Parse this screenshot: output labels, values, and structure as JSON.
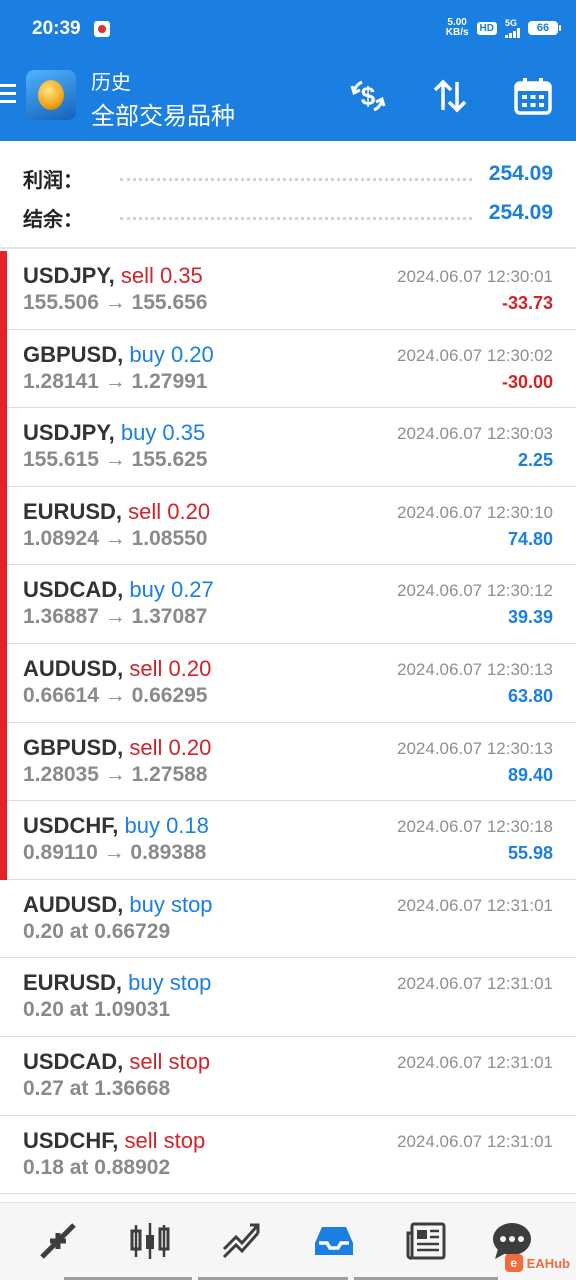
{
  "status_bar": {
    "time": "20:39",
    "net_speed_value": "5.00",
    "net_speed_unit": "KB/s",
    "hd_label": "HD",
    "signal_label": "5G",
    "battery": "66"
  },
  "header": {
    "section": "历史",
    "filter": "全部交易品种",
    "icons": [
      "menu-icon",
      "app-logo",
      "currency-exchange-icon",
      "sort-icon",
      "calendar-icon"
    ]
  },
  "summary": {
    "profit_label": "利润：",
    "profit_value": "254.09",
    "balance_label": "结余：",
    "balance_value": "254.09"
  },
  "trades": [
    {
      "symbol": "USDJPY",
      "sep": ",",
      "type": "sell 0.35",
      "side": "sell",
      "prices": "155.506 → 155.656",
      "time": "2024.06.07 12:30:01",
      "profit": "-33.73",
      "closed": true
    },
    {
      "symbol": "GBPUSD",
      "sep": ",",
      "type": "buy 0.20",
      "side": "buy",
      "prices": "1.28141 → 1.27991",
      "time": "2024.06.07 12:30:02",
      "profit": "-30.00",
      "closed": true
    },
    {
      "symbol": "USDJPY",
      "sep": ",",
      "type": "buy 0.35",
      "side": "buy",
      "prices": "155.615 → 155.625",
      "time": "2024.06.07 12:30:03",
      "profit": "2.25",
      "closed": true
    },
    {
      "symbol": "EURUSD",
      "sep": ",",
      "type": "sell 0.20",
      "side": "sell",
      "prices": "1.08924 → 1.08550",
      "time": "2024.06.07 12:30:10",
      "profit": "74.80",
      "closed": true
    },
    {
      "symbol": "USDCAD",
      "sep": ",",
      "type": "buy 0.27",
      "side": "buy",
      "prices": "1.36887 → 1.37087",
      "time": "2024.06.07 12:30:12",
      "profit": "39.39",
      "closed": true
    },
    {
      "symbol": "AUDUSD",
      "sep": ",",
      "type": "sell 0.20",
      "side": "sell",
      "prices": "0.66614 → 0.66295",
      "time": "2024.06.07 12:30:13",
      "profit": "63.80",
      "closed": true
    },
    {
      "symbol": "GBPUSD",
      "sep": ",",
      "type": "sell 0.20",
      "side": "sell",
      "prices": "1.28035 → 1.27588",
      "time": "2024.06.07 12:30:13",
      "profit": "89.40",
      "closed": true
    },
    {
      "symbol": "USDCHF",
      "sep": ",",
      "type": "buy 0.18",
      "side": "buy",
      "prices": "0.89110 → 0.89388",
      "time": "2024.06.07 12:30:18",
      "profit": "55.98",
      "closed": true
    },
    {
      "symbol": "AUDUSD",
      "sep": ",",
      "type": "buy stop",
      "side": "buy",
      "prices": "0.20 at 0.66729",
      "time": "2024.06.07 12:31:01",
      "profit": "",
      "closed": false
    },
    {
      "symbol": "EURUSD",
      "sep": ",",
      "type": "buy stop",
      "side": "buy",
      "prices": "0.20 at 1.09031",
      "time": "2024.06.07 12:31:01",
      "profit": "",
      "closed": false
    },
    {
      "symbol": "USDCAD",
      "sep": ",",
      "type": "sell stop",
      "side": "sell",
      "prices": "0.27 at 1.36668",
      "time": "2024.06.07 12:31:01",
      "profit": "",
      "closed": false
    },
    {
      "symbol": "USDCHF",
      "sep": ",",
      "type": "sell stop",
      "side": "sell",
      "prices": "0.18 at 0.88902",
      "time": "2024.06.07 12:31:01",
      "profit": "",
      "closed": false
    }
  ],
  "bottom_nav": {
    "items": [
      "quotes-icon",
      "chart-icon",
      "trade-icon",
      "history-icon",
      "news-icon",
      "messages-icon"
    ],
    "active": "history-icon"
  },
  "watermark": {
    "text": "EAHub"
  },
  "colors": {
    "primary": "#1a7fe0",
    "negative": "#d2232a",
    "closed_marker": "#e8202a"
  }
}
